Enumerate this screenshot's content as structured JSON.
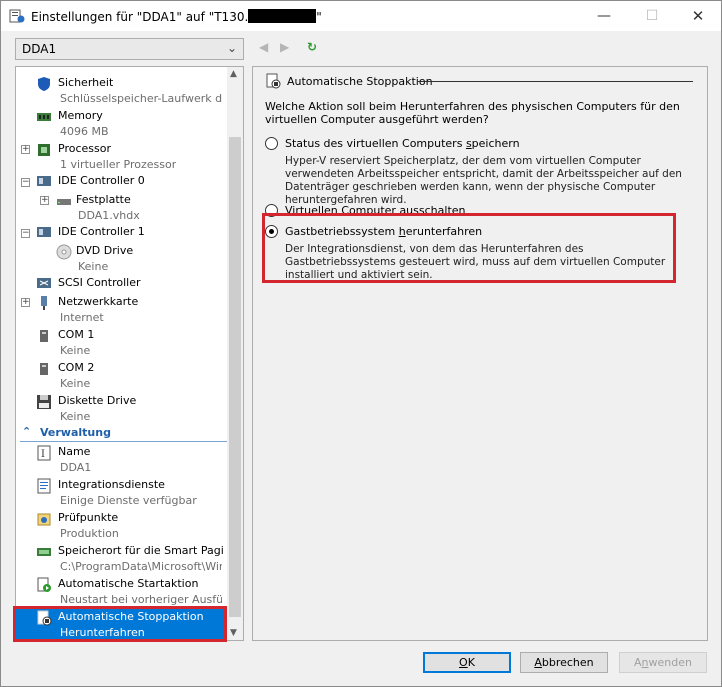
{
  "window": {
    "title_prefix": "Einstellungen für \"DDA1\" auf \"T130.",
    "title_suffix": "\"",
    "min_glyph": "—",
    "max_glyph": "☐",
    "close_glyph": "✕"
  },
  "toolbar": {
    "vm_selected": "DDA1",
    "back_glyph": "◀",
    "forward_glyph": "▶",
    "refresh_glyph": "↻"
  },
  "tree": {
    "items": [
      {
        "label": "Sicherheit",
        "sub": "Schlüsselspeicher-Laufwerk de...",
        "icon": "shield-icon"
      },
      {
        "label": "Memory",
        "sub": "4096 MB",
        "icon": "memory-icon"
      },
      {
        "label": "Processor",
        "sub": "1 virtueller Prozessor",
        "icon": "processor-icon"
      },
      {
        "label": "IDE Controller 0",
        "sub": "",
        "icon": "controller-icon"
      },
      {
        "label": "Festplatte",
        "sub": "DDA1.vhdx",
        "icon": "disk-icon"
      },
      {
        "label": "IDE Controller 1",
        "sub": "",
        "icon": "controller-icon"
      },
      {
        "label": "DVD Drive",
        "sub": "Keine",
        "icon": "dvd-icon"
      },
      {
        "label": "SCSI Controller",
        "sub": "",
        "icon": "scsi-icon"
      },
      {
        "label": "Netzwerkkarte",
        "sub": "Internet",
        "icon": "network-icon"
      },
      {
        "label": "COM 1",
        "sub": "Keine",
        "icon": "com-port-icon"
      },
      {
        "label": "COM 2",
        "sub": "Keine",
        "icon": "com-port-icon"
      },
      {
        "label": "Diskette Drive",
        "sub": "Keine",
        "icon": "floppy-icon"
      },
      {
        "label": "Name",
        "sub": "DDA1",
        "icon": "name-icon"
      },
      {
        "label": "Integrationsdienste",
        "sub": "Einige Dienste verfügbar",
        "icon": "integration-icon"
      },
      {
        "label": "Prüfpunkte",
        "sub": "Produktion",
        "icon": "checkpoint-icon"
      },
      {
        "label": "Speicherort für die Smart Pagin...",
        "sub": "C:\\ProgramData\\Microsoft\\Win...",
        "icon": "smart-paging-icon"
      },
      {
        "label": "Automatische Startaktion",
        "sub": "Neustart bei vorheriger Ausfüh...",
        "icon": "start-action-icon"
      },
      {
        "label": "Automatische Stoppaktion",
        "sub": "Herunterfahren",
        "icon": "stop-action-icon"
      }
    ],
    "section_label": "Verwaltung",
    "expanders": {
      "plus": "+",
      "minus": "−"
    },
    "scroll_up": "▲",
    "scroll_down": "▼"
  },
  "panel": {
    "header": "Automatische Stoppaktion",
    "question": "Welche Aktion soll beim Herunterfahren des physischen Computers für den virtuellen Computer ausgeführt werden?",
    "options": [
      {
        "label_pre": "Status des virtuellen Computers ",
        "label_ul": "s",
        "label_post": "peichern",
        "desc": "Hyper-V reserviert Speicherplatz, der dem vom virtuellen Computer verwendeten Arbeitsspeicher entspricht, damit der Arbeitsspeicher auf den Datenträger geschrieben werden kann, wenn der physische Computer heruntergefahren wird.",
        "selected": false
      },
      {
        "label_pre": "Virtuellen Computer aus",
        "label_ul": "s",
        "label_post": "chalten",
        "desc": "",
        "selected": false
      },
      {
        "label_pre": "Gastbetriebssystem ",
        "label_ul": "h",
        "label_post": "erunterfahren",
        "desc": "Der Integrationsdienst, von dem das Herunterfahren des Gastbetriebssystems gesteuert wird, muss auf dem virtuellen Computer installiert und aktiviert sein.",
        "selected": true
      }
    ]
  },
  "buttons": {
    "ok": {
      "ul": "O",
      "rest": "K"
    },
    "cancel": {
      "ul": "A",
      "rest": "bbrechen"
    },
    "apply": {
      "pre": "A",
      "ul": "n",
      "rest": "wenden"
    }
  },
  "colors": {
    "accent": "#0078d7",
    "highlight_red": "#d3262f",
    "section_blue": "#1f5fa8"
  }
}
